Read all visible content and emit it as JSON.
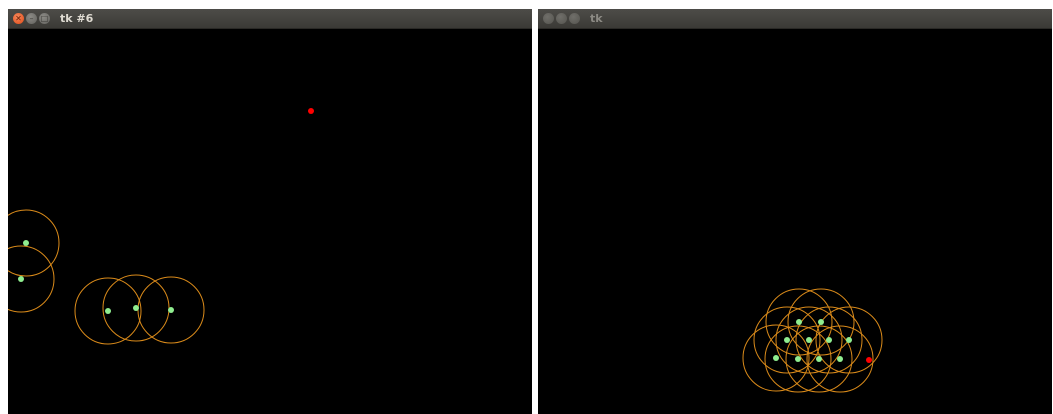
{
  "windows": [
    {
      "title": "tk #6",
      "active": true,
      "colors": {
        "background": "#000000",
        "ring": "#d98a1a",
        "agent": "#90ee90",
        "target": "#ff0000"
      }
    },
    {
      "title": "tk",
      "active": false,
      "colors": {
        "background": "#000000",
        "ring": "#d98a1a",
        "agent": "#90ee90",
        "target": "#ff0000"
      }
    }
  ],
  "icons": {
    "close": "close-icon",
    "minimize": "minimize-icon",
    "maximize": "maximize-icon"
  }
}
